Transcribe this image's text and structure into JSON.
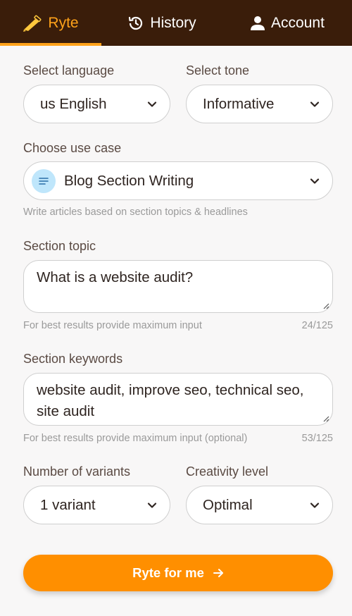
{
  "nav": {
    "ryte": "Ryte",
    "history": "History",
    "account": "Account"
  },
  "language": {
    "label": "Select language",
    "value": "us English"
  },
  "tone": {
    "label": "Select tone",
    "value": "Informative"
  },
  "usecase": {
    "label": "Choose use case",
    "value": "Blog Section Writing",
    "hint": "Write articles based on section topics & headlines"
  },
  "topic": {
    "label": "Section topic",
    "value": "What is a website audit?",
    "hint": "For best results provide maximum input",
    "count": "24/125"
  },
  "keywords": {
    "label": "Section keywords",
    "value": "website audit, improve seo, technical seo, site audit",
    "hint": "For best results provide maximum input (optional)",
    "count": "53/125"
  },
  "variants": {
    "label": "Number of variants",
    "value": "1 variant"
  },
  "creativity": {
    "label": "Creativity level",
    "value": "Optimal"
  },
  "submit": {
    "label": "Ryte for me"
  },
  "colors": {
    "nav_bg": "#3a1d0a",
    "accent": "#ffa21a",
    "button": "#ff8f00"
  }
}
